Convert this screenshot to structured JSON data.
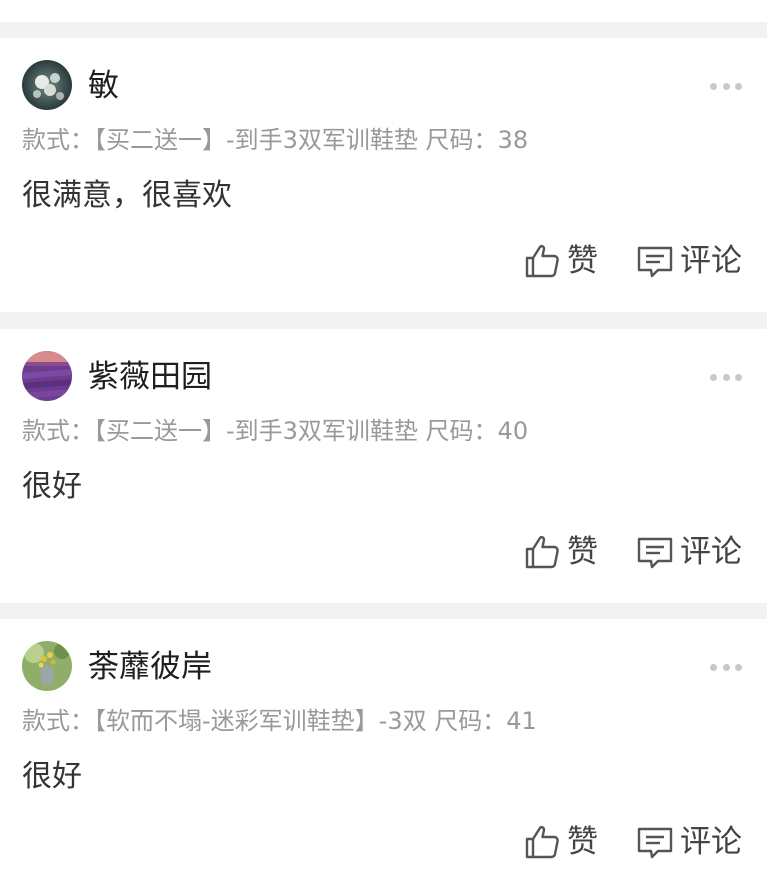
{
  "reviews": [
    {
      "username": "敏",
      "style_line": "款式：【买二送一】-到手3双军训鞋垫 尺码：38",
      "comment": "很满意，很喜欢",
      "like_label": "赞",
      "comment_label": "评论",
      "avatar_icon": "coral-photo-avatar"
    },
    {
      "username": "紫薇田园",
      "style_line": "款式：【买二送一】-到手3双军训鞋垫 尺码：40",
      "comment": "很好",
      "like_label": "赞",
      "comment_label": "评论",
      "avatar_icon": "lavender-field-avatar"
    },
    {
      "username": "荼蘼彼岸",
      "style_line": "款式：【软而不塌-迷彩军训鞋垫】-3双 尺码：41",
      "comment": "很好",
      "like_label": "赞",
      "comment_label": "评论",
      "avatar_icon": "flower-vase-avatar"
    }
  ],
  "icons": {
    "more": "more-dots-icon",
    "like": "thumbs-up-icon",
    "comment": "comment-bubble-icon"
  },
  "colors": {
    "background": "#f2f2f2",
    "card": "#ffffff",
    "meta_text": "#999999",
    "username_text": "#1f1f1f"
  }
}
